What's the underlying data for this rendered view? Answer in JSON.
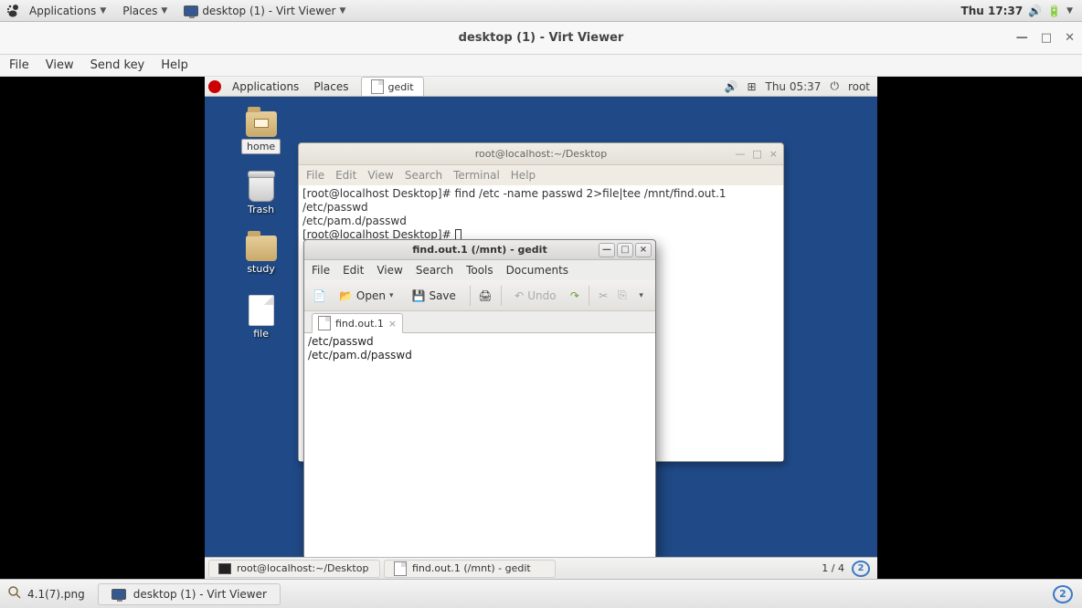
{
  "host_panel": {
    "apps": "Applications",
    "places": "Places",
    "active_window": "desktop (1) - Virt Viewer",
    "clock": "Thu 17:37"
  },
  "virt_viewer": {
    "title": "desktop (1) - Virt Viewer",
    "menu": {
      "file": "File",
      "view": "View",
      "sendkey": "Send key",
      "help": "Help"
    }
  },
  "guest_panel": {
    "apps": "Applications",
    "places": "Places",
    "active_tab": "gedit",
    "clock": "Thu 05:37",
    "user": "root"
  },
  "desktop": {
    "home": "home",
    "trash": "Trash",
    "study": "study",
    "file": "file"
  },
  "terminal": {
    "title": "root@localhost:~/Desktop",
    "menu": {
      "file": "File",
      "edit": "Edit",
      "view": "View",
      "search": "Search",
      "terminal": "Terminal",
      "help": "Help"
    },
    "lines": {
      "l1": "[root@localhost Desktop]# find /etc -name passwd 2>file|tee /mnt/find.out.1",
      "l2": "/etc/passwd",
      "l3": "/etc/pam.d/passwd",
      "l4": "[root@localhost Desktop]# "
    }
  },
  "gedit": {
    "title": "find.out.1 (/mnt) - gedit",
    "menu": {
      "file": "File",
      "edit": "Edit",
      "view": "View",
      "search": "Search",
      "tools": "Tools",
      "documents": "Documents"
    },
    "toolbar": {
      "open": "Open",
      "save": "Save",
      "undo": "Undo"
    },
    "tab": "find.out.1",
    "body": {
      "l1": "/etc/passwd",
      "l2": "/etc/pam.d/passwd"
    }
  },
  "guest_bottom": {
    "task1": "root@localhost:~/Desktop",
    "task2": "find.out.1 (/mnt) - gedit",
    "workspace": "1 / 4",
    "pager": "2"
  },
  "host_bottom": {
    "thumb": "4.1(7).png",
    "task": "desktop (1) - Virt Viewer",
    "pager": "2"
  }
}
